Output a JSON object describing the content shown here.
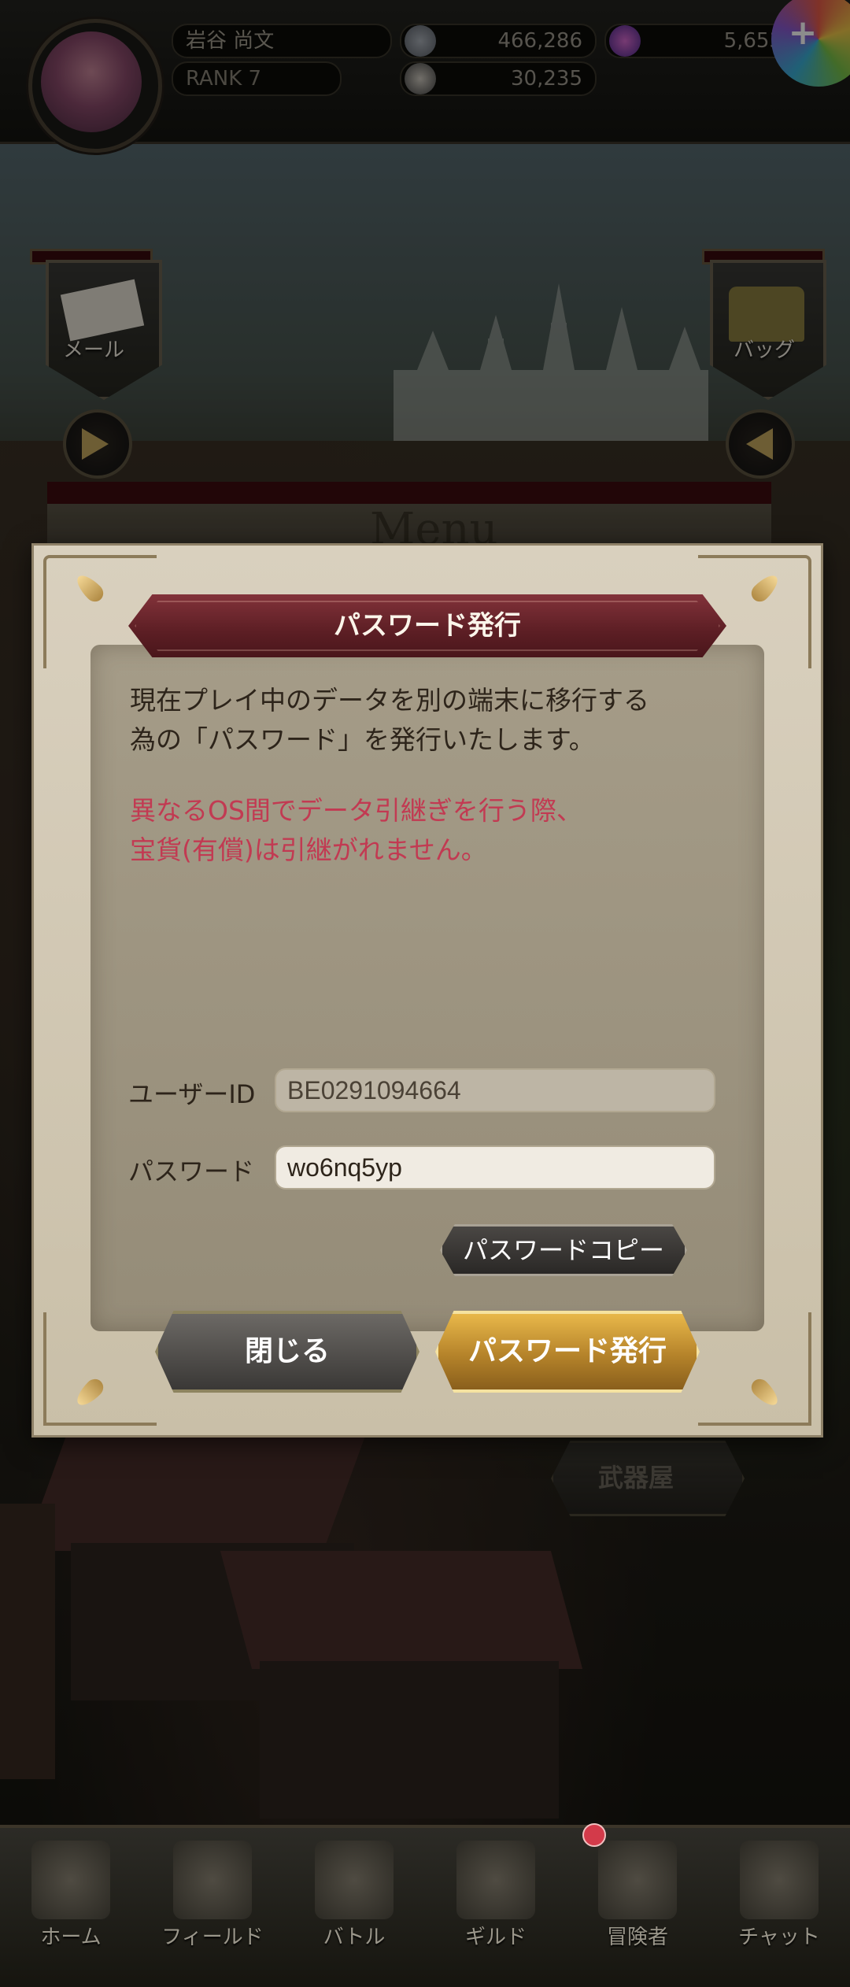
{
  "hud": {
    "player_name": "岩谷 尚文",
    "rank": "RANK 7",
    "currency1": "466,286",
    "currency2": "5,653",
    "power": "30,235"
  },
  "side": {
    "mail": "メール",
    "bag": "バッグ"
  },
  "menu_board_title": "Menu",
  "dialog": {
    "title": "パスワード発行",
    "info_line1": "現在プレイ中のデータを別の端末に移行する",
    "info_line2": "為の「パスワード」を発行いたします。",
    "warn_line1": "異なるOS間でデータ引継ぎを行う際、",
    "warn_line2": "宝貨(有償)は引継がれません。",
    "user_id_label": "ユーザーID",
    "user_id_value": "BE0291094664",
    "password_label": "パスワード",
    "password_value": "wo6nq5yp",
    "copy_label": "パスワードコピー",
    "close_label": "閉じる",
    "issue_label": "パスワード発行"
  },
  "shop_label": "武器屋",
  "nav": [
    {
      "label": "ホーム"
    },
    {
      "label": "フィールド"
    },
    {
      "label": "バトル"
    },
    {
      "label": "ギルド"
    },
    {
      "label": "冒険者"
    },
    {
      "label": "チャット"
    }
  ],
  "colors": {
    "warning_text": "#c23a52",
    "title_bar": "#5c1e24",
    "issue_button": "#b5832a"
  }
}
